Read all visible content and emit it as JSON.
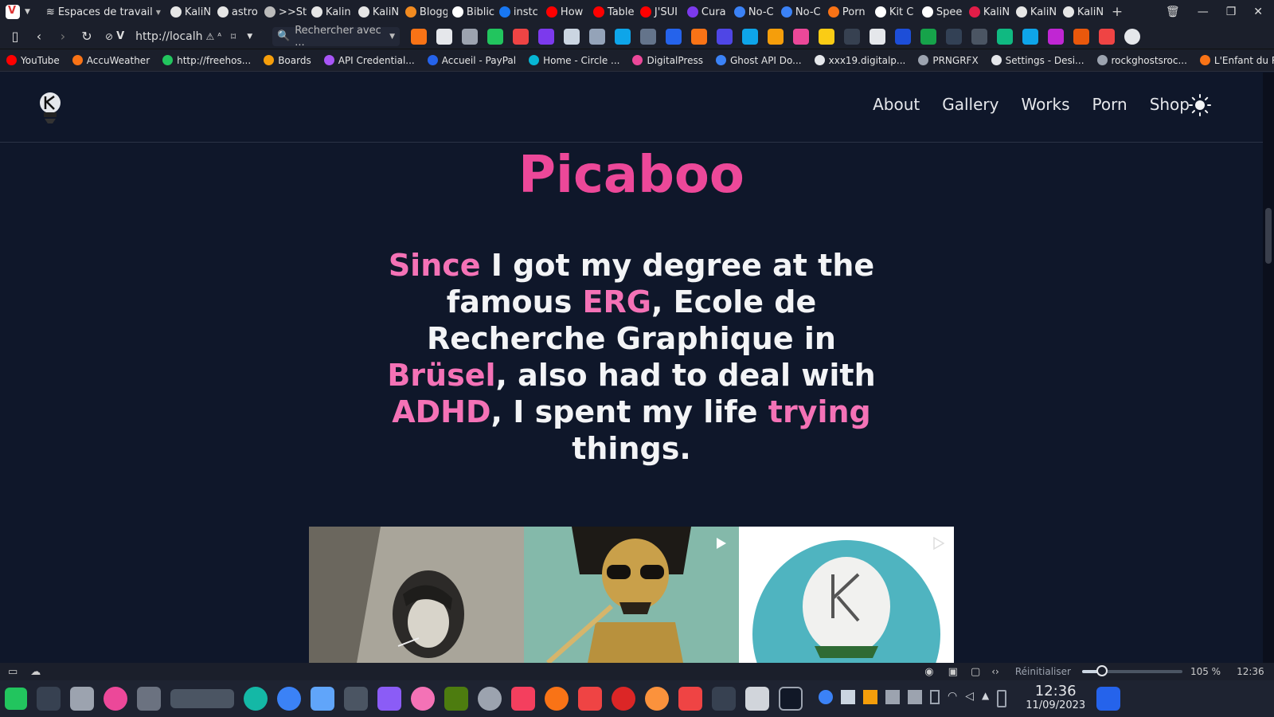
{
  "browser": {
    "workspace_label": "Espaces de travail",
    "tabs": [
      {
        "label": "KaliN",
        "color": "#e6e6e6"
      },
      {
        "label": "astro",
        "color": "#e6e6e6"
      },
      {
        "label": ">>Sta",
        "color": "#bbbbbb"
      },
      {
        "label": "Kalin",
        "color": "#e6e6e6"
      },
      {
        "label": "KaliN",
        "color": "#e6e6e6"
      },
      {
        "label": "Blogg",
        "color": "#f28b20"
      },
      {
        "label": "Biblic",
        "color": "#ffffff"
      },
      {
        "label": "instc",
        "color": "#1877f2"
      },
      {
        "label": "How",
        "color": "#ff0000"
      },
      {
        "label": "Table",
        "color": "#ff0000"
      },
      {
        "label": "J'SUI",
        "color": "#ff0000"
      },
      {
        "label": "Cura",
        "color": "#7c3aed"
      },
      {
        "label": "No-C",
        "color": "#3b82f6"
      },
      {
        "label": "No-C",
        "color": "#3b82f6"
      },
      {
        "label": "Porn",
        "color": "#f97316"
      },
      {
        "label": "Kit C",
        "color": "#ffffff"
      },
      {
        "label": "Spee",
        "color": "#ffffff"
      },
      {
        "label": "KaliN",
        "color": "#e11d48"
      },
      {
        "label": "KaliN",
        "color": "#e6e6e6"
      },
      {
        "label": "KaliN",
        "color": "#e6e6e6"
      }
    ],
    "url": "http://localh",
    "search_placeholder": "Rechercher avec ...",
    "bookmarks": [
      {
        "label": "YouTube",
        "color": "#ff0000"
      },
      {
        "label": "AccuWeather",
        "color": "#f97316"
      },
      {
        "label": "http://freehos...",
        "color": "#22c55e"
      },
      {
        "label": "Boards",
        "color": "#f59e0b"
      },
      {
        "label": "API Credential...",
        "color": "#a855f7"
      },
      {
        "label": "Accueil - PayPal",
        "color": "#2563eb"
      },
      {
        "label": "Home - Circle ...",
        "color": "#06b6d4"
      },
      {
        "label": "DigitalPress",
        "color": "#ec4899"
      },
      {
        "label": "Ghost API Do...",
        "color": "#3b82f6"
      },
      {
        "label": "xxx19.digitalp...",
        "color": "#e5e7eb"
      },
      {
        "label": "PRNGRFX",
        "color": "#9ca3af"
      },
      {
        "label": "Settings - Desi...",
        "color": "#e5e7eb"
      },
      {
        "label": "rockghostsroc...",
        "color": "#9ca3af"
      },
      {
        "label": "L'Enfant du R...",
        "color": "#f97316"
      }
    ]
  },
  "site": {
    "nav": [
      "About",
      "Gallery",
      "Works",
      "Porn",
      "Shop"
    ],
    "title": "Picaboo",
    "intro": [
      {
        "t": "Since",
        "hl": true
      },
      {
        "t": " I got my degree at the famous ",
        "hl": false
      },
      {
        "t": "ERG",
        "hl": true
      },
      {
        "t": ", Ecole de Recherche Graphique in ",
        "hl": false
      },
      {
        "t": "Brüsel",
        "hl": true
      },
      {
        "t": ", also had to deal with ",
        "hl": false
      },
      {
        "t": "ADHD",
        "hl": true
      },
      {
        "t": ", I spent my life ",
        "hl": false
      },
      {
        "t": "trying",
        "hl": true
      },
      {
        "t": " things.",
        "hl": false
      }
    ],
    "colors": {
      "accent": "#ec4899",
      "accent_light": "#f472b6",
      "background": "#0f172a"
    }
  },
  "statusbar": {
    "reset_label": "Réinitialiser",
    "zoom": "105 %",
    "zoom_fraction": 0.2,
    "time": "12:36"
  },
  "taskbar": {
    "clock_time": "12:36",
    "clock_date": "11/09/2023"
  }
}
